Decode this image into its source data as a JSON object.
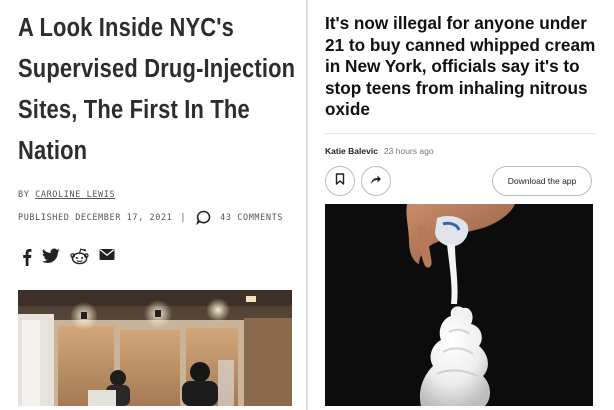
{
  "left_article": {
    "headline": "A Look Inside NYC's Supervised Drug-Injection Sites, The First In The Nation",
    "byline_prefix": "BY",
    "author": "CAROLINE LEWIS",
    "published_prefix": "PUBLISHED",
    "published_date": "DECEMBER 17, 2021",
    "separator": "|",
    "comments_count": "43 COMMENTS",
    "share_icons": [
      "facebook-icon",
      "twitter-icon",
      "reddit-icon",
      "email-icon"
    ],
    "photo": "injection-booths-photo"
  },
  "right_article": {
    "headline": "It's now illegal for anyone under 21 to buy canned whipped cream in New York, officials say it's to stop teens from inhaling nitrous oxide",
    "author": "Katie Balevic",
    "time_ago": "23 hours ago",
    "bookmark_icon": "bookmark-icon",
    "share_icon": "share-arrow-icon",
    "download_label": "Download the app",
    "photo": "whipped-cream-photo"
  },
  "colors": {
    "headline_left": "#2d2d2d",
    "headline_right": "#111111",
    "meta_gray": "#555555",
    "border_gray": "#bbbbbb"
  }
}
